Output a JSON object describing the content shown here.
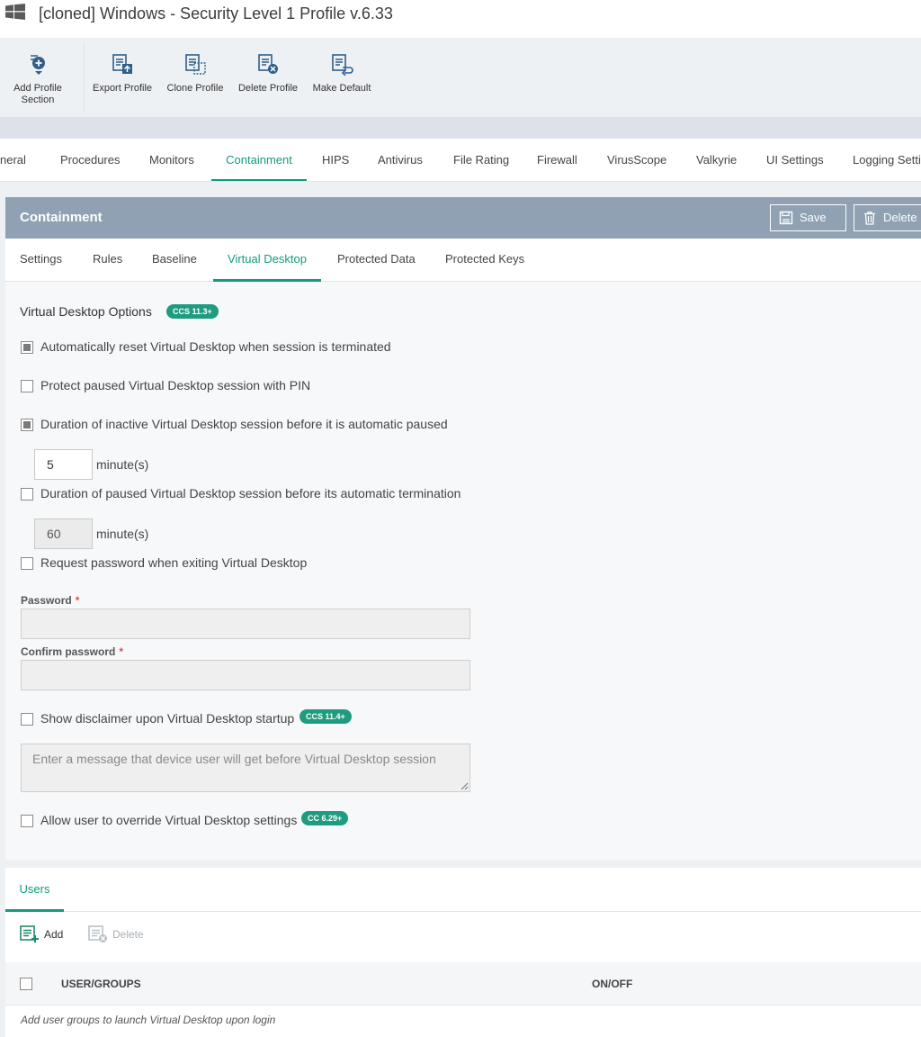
{
  "window": {
    "title": "[cloned] Windows - Security Level 1 Profile v.6.33",
    "icon": "windows-logo-icon"
  },
  "toolbar": {
    "add_section": "Add Profile Section",
    "export": "Export Profile",
    "clone": "Clone Profile",
    "delete": "Delete Profile",
    "make_default": "Make Default"
  },
  "main_tabs": {
    "general": "neral",
    "procedures": "Procedures",
    "monitors": "Monitors",
    "containment": "Containment",
    "hips": "HIPS",
    "antivirus": "Antivirus",
    "file_rating": "File Rating",
    "firewall": "Firewall",
    "virusscope": "VirusScope",
    "valkyrie": "Valkyrie",
    "ui_settings": "UI Settings",
    "logging": "Logging Setti"
  },
  "panel": {
    "title": "Containment",
    "save": "Save",
    "delete": "Delete",
    "subtabs": {
      "settings": "Settings",
      "rules": "Rules",
      "baseline": "Baseline",
      "virtual_desktop": "Virtual Desktop",
      "protected_data": "Protected Data",
      "protected_keys": "Protected Keys"
    }
  },
  "vd": {
    "section_title": "Virtual Desktop Options",
    "section_badge": "CCS 11.3+",
    "opt_auto_reset": {
      "label": "Automatically reset Virtual Desktop when session is terminated",
      "checked": true
    },
    "opt_pin": {
      "label": "Protect paused Virtual Desktop session with PIN",
      "checked": false
    },
    "opt_inactive": {
      "label": "Duration of inactive Virtual Desktop session before it is automatic paused",
      "checked": true,
      "value": "5",
      "unit": "minute(s)"
    },
    "opt_paused": {
      "label": "Duration of paused Virtual Desktop session before its automatic termination",
      "checked": false,
      "value": "60",
      "unit": "minute(s)"
    },
    "opt_password": {
      "label": "Request password when exiting Virtual Desktop",
      "checked": false
    },
    "password_label": "Password",
    "confirm_label": "Confirm password",
    "required_mark": "*",
    "opt_disclaimer": {
      "label": "Show disclaimer upon Virtual Desktop startup",
      "checked": false,
      "badge": "CCS 11.4+"
    },
    "disclaimer_placeholder": "Enter a message that device user will get before Virtual Desktop session",
    "opt_override": {
      "label": "Allow user to override Virtual Desktop settings",
      "checked": false,
      "badge": "CC 6.29+"
    }
  },
  "users": {
    "tab": "Users",
    "add": "Add",
    "delete": "Delete",
    "col_user_groups": "USER/GROUPS",
    "col_on_off": "ON/OFF",
    "empty_message": "Add user groups to launch Virtual Desktop upon login"
  },
  "colors": {
    "accent": "#139b7e",
    "badge": "#1f9c7f",
    "panel_header": "#8fa1b2",
    "toolbar_icon": "#2f5f8a"
  }
}
